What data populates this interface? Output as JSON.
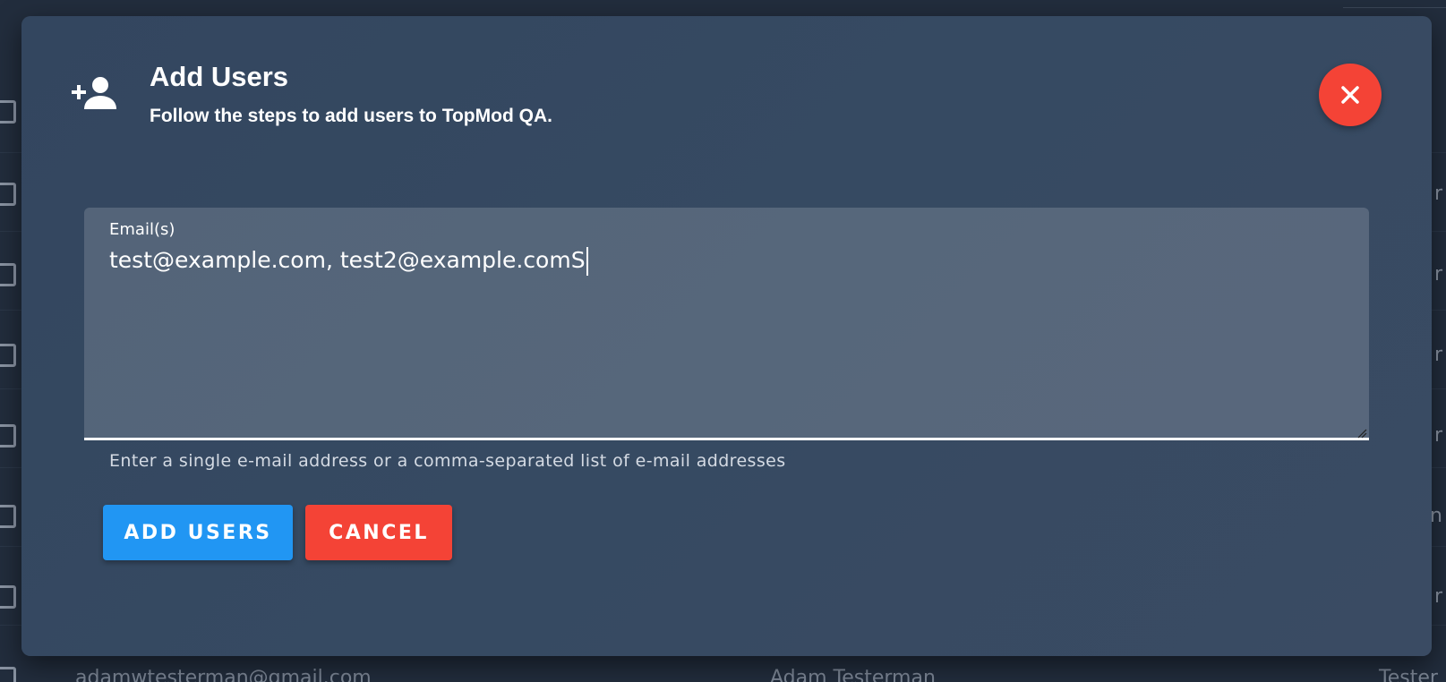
{
  "dialog": {
    "title": "Add Users",
    "subtitle": "Follow the steps to add users to TopMod QA.",
    "icon": "person-add-icon",
    "close_icon": "close-icon"
  },
  "email_field": {
    "label": "Email(s)",
    "value": "test@example.com, test2@example.comS",
    "hint": "Enter a single e-mail address or a comma-separated list of e-mail addresses"
  },
  "actions": {
    "add_label": "ADD USERS",
    "cancel_label": "CANCEL"
  },
  "background": {
    "row_email": "adamwtesterman@gmail.com",
    "row_name": "Adam Testerman",
    "row_role": "Tester",
    "right_letters": [
      "r",
      "r",
      "r",
      "r",
      "n",
      "r"
    ]
  },
  "colors": {
    "dialog_bg": "#34475f",
    "primary": "#2196f3",
    "danger": "#f44336",
    "page_bg": "#222d3d"
  }
}
